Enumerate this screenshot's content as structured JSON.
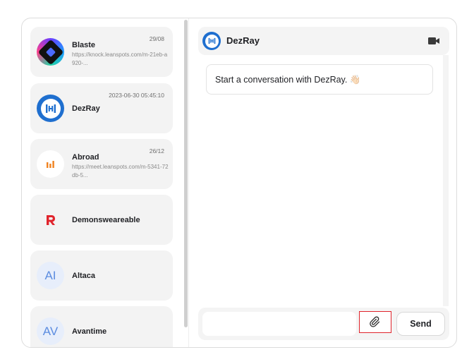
{
  "conversations": [
    {
      "name": "Blaste",
      "date": "29/08",
      "preview": "https://knock.leanspots.com/m-21eb-a920-..."
    },
    {
      "name": "DezRay",
      "date": "2023-06-30 05:45:10",
      "preview": ""
    },
    {
      "name": "Abroad",
      "date": "26/12",
      "preview": "https://meet.leanspots.com/m-5341-72db-5..."
    },
    {
      "name": "Demonsweareable",
      "date": "",
      "preview": ""
    },
    {
      "name": "Altaca",
      "date": "",
      "preview": "",
      "initials": "AI"
    },
    {
      "name": "Avantime",
      "date": "",
      "preview": "",
      "initials": "AV"
    }
  ],
  "chat": {
    "title": "DezRay",
    "welcome": "Start a conversation with DezRay. 👋🏻",
    "input_placeholder": "",
    "send_label": "Send"
  },
  "colors": {
    "brand_blue": "#1f6fcf",
    "highlight_red": "#e0242c"
  }
}
